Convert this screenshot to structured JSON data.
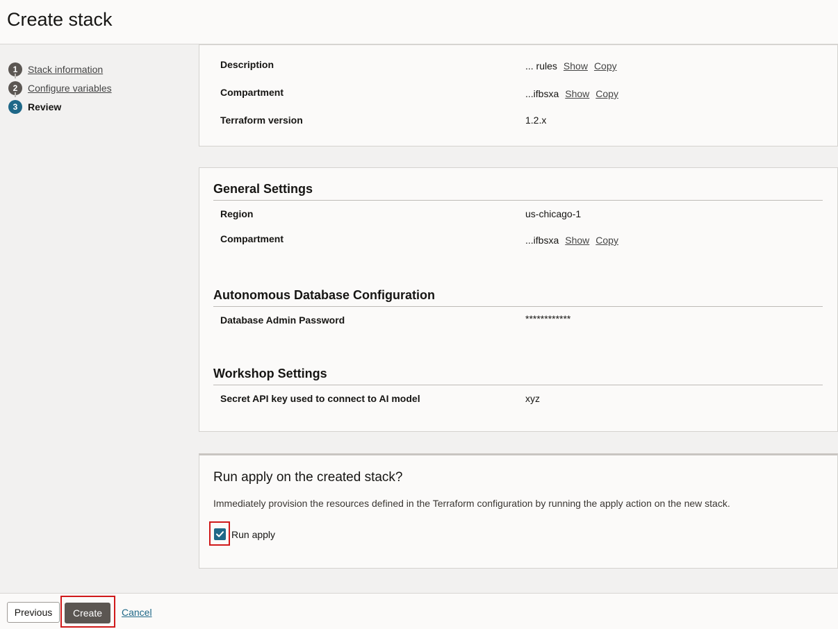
{
  "page_title": "Create stack",
  "steps": [
    {
      "number": "1",
      "label": "Stack information"
    },
    {
      "number": "2",
      "label": "Configure variables"
    },
    {
      "number": "3",
      "label": "Review"
    }
  ],
  "stack_info": {
    "description": {
      "label": "Description",
      "value": "... rules",
      "show": "Show",
      "copy": "Copy"
    },
    "compartment": {
      "label": "Compartment",
      "value": "...ifbsxa",
      "show": "Show",
      "copy": "Copy"
    },
    "terraform": {
      "label": "Terraform version",
      "value": "1.2.x"
    }
  },
  "general_settings": {
    "title": "General Settings",
    "region": {
      "label": "Region",
      "value": "us-chicago-1"
    },
    "compartment": {
      "label": "Compartment",
      "value": "...ifbsxa",
      "show": "Show",
      "copy": "Copy"
    }
  },
  "adb_config": {
    "title": "Autonomous Database Configuration",
    "password": {
      "label": "Database Admin Password",
      "value": "************"
    }
  },
  "workshop": {
    "title": "Workshop Settings",
    "secret": {
      "label": "Secret API key used to connect to AI model",
      "value": "xyz"
    }
  },
  "run_apply": {
    "title": "Run apply on the created stack?",
    "description": "Immediately provision the resources defined in the Terraform configuration by running the apply action on the new stack.",
    "checkbox_label": "Run apply",
    "checked": true
  },
  "footer": {
    "previous": "Previous",
    "create": "Create",
    "cancel": "Cancel"
  },
  "colors": {
    "accent": "#1f6888",
    "highlight": "#d0191a",
    "primary_button": "#5b5652"
  }
}
